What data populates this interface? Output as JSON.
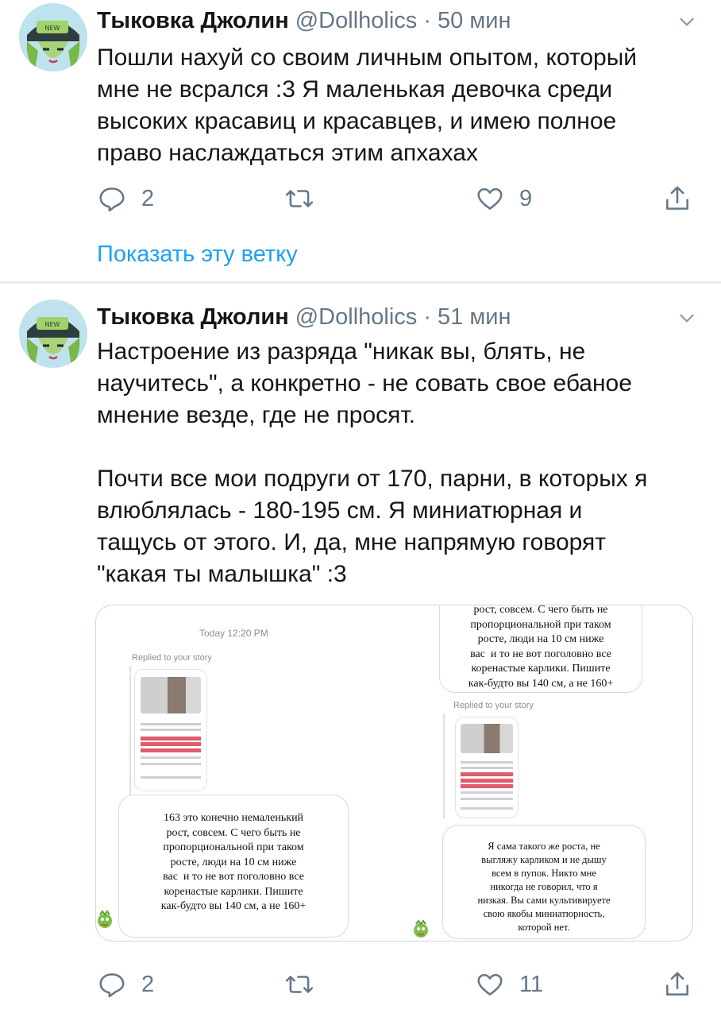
{
  "tweets": [
    {
      "name": "Тыковка Джолин",
      "meta": "@Dollholics · 50 мин",
      "text": "Пошли нахуй со своим личным опытом, который\nмне не всрался :3 Я маленькая девочка среди\nвысоких красавиц и красавцев, и имею полное\nправо наслаждаться этим апхахах",
      "reply_count": "2",
      "retweet_count": "",
      "like_count": "9",
      "show_thread": "Показать эту ветку"
    },
    {
      "name": "Тыковка Джолин",
      "meta": "@Dollholics · 51 мин",
      "text": "Настроение из разряда \"никак вы, блять, не\nнаучитесь\", а конкретно - не совать свое ебаное\nмнение везде, где не просят.\n\nПочти все мои подруги от 170, парни, в которых я\nвлюблялась - 180-195 см. Я миниатюрная и\nтащусь от этого. И, да, мне напрямую говорят\n\"какая ты малышка\" :3",
      "reply_count": "2",
      "retweet_count": "",
      "like_count": "11",
      "media": {
        "date": "Today 12:20 PM",
        "replied_label": "Replied to your story",
        "bubble_left": "163 это конечно немаленький\nрост, совсем. С чего быть не\nпропорциональной при таком\nросте, люди на 10 см ниже\nвас  и то не вот поголовно все\nкоренастые карлики. Пишите\nкак-будто вы 140 см, а не 160+",
        "bubble_right_top": "рост, совсем. С чего быть не\nпропорциональной при таком\nросте, люди на 10 см ниже\nвас  и то не вот поголовно все\nкоренастые карлики. Пишите\nкак-будто вы 140 см, а не 160+",
        "bubble_right": "Я сама такого же роста, не\nвыгляжу карликом и не дышу\nвсем в пупок. Никто мне\nникогда не говорил, что я\nнизкая. Вы сами культивируете\nсвою якобы миниатюрность,\nкоторой нет."
      }
    }
  ],
  "icons": {
    "reply": "reply-icon",
    "retweet": "retweet-icon",
    "like": "like-icon",
    "share": "share-icon",
    "menu": "chevron-down-icon"
  },
  "colors": {
    "link": "#1da1f2",
    "secondary": "#657786",
    "divider": "#e6ecf0"
  }
}
